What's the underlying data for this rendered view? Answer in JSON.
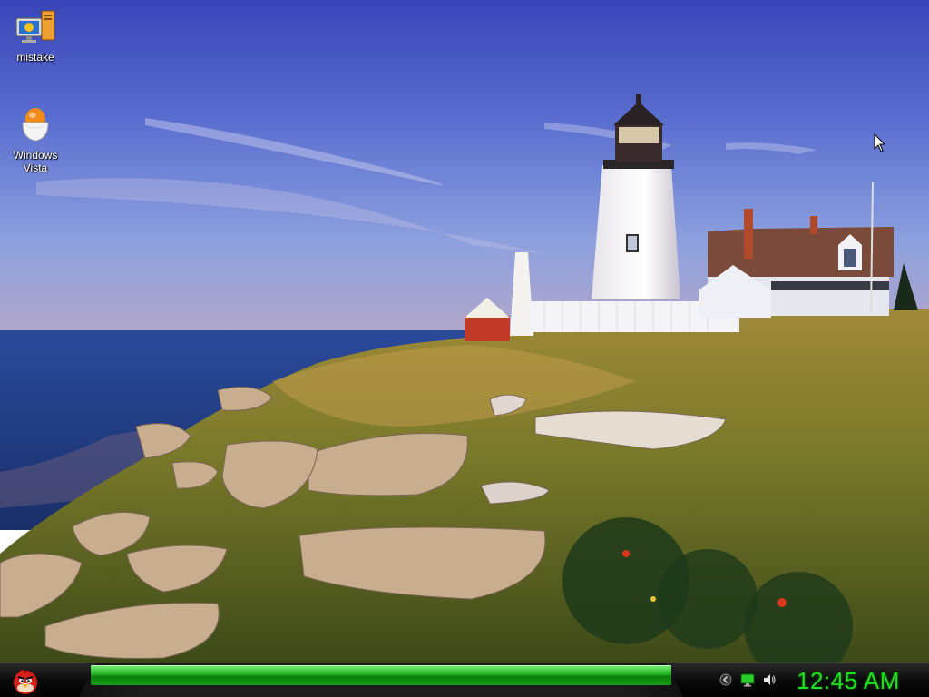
{
  "desktop": {
    "icons": [
      {
        "label": "mistake",
        "icon": "computer-icon"
      },
      {
        "label": "Windows\nVista",
        "icon": "egg-cup-icon"
      }
    ],
    "wallpaper": "lighthouse-coast-scene"
  },
  "taskbar": {
    "start_icon": "angry-bird-icon",
    "active_task_color": "#22b522",
    "tray_icons": [
      "chevron-left-icon",
      "network-monitor-icon",
      "speaker-icon"
    ],
    "clock": "12:45 AM",
    "clock_color": "#1ee01e"
  }
}
